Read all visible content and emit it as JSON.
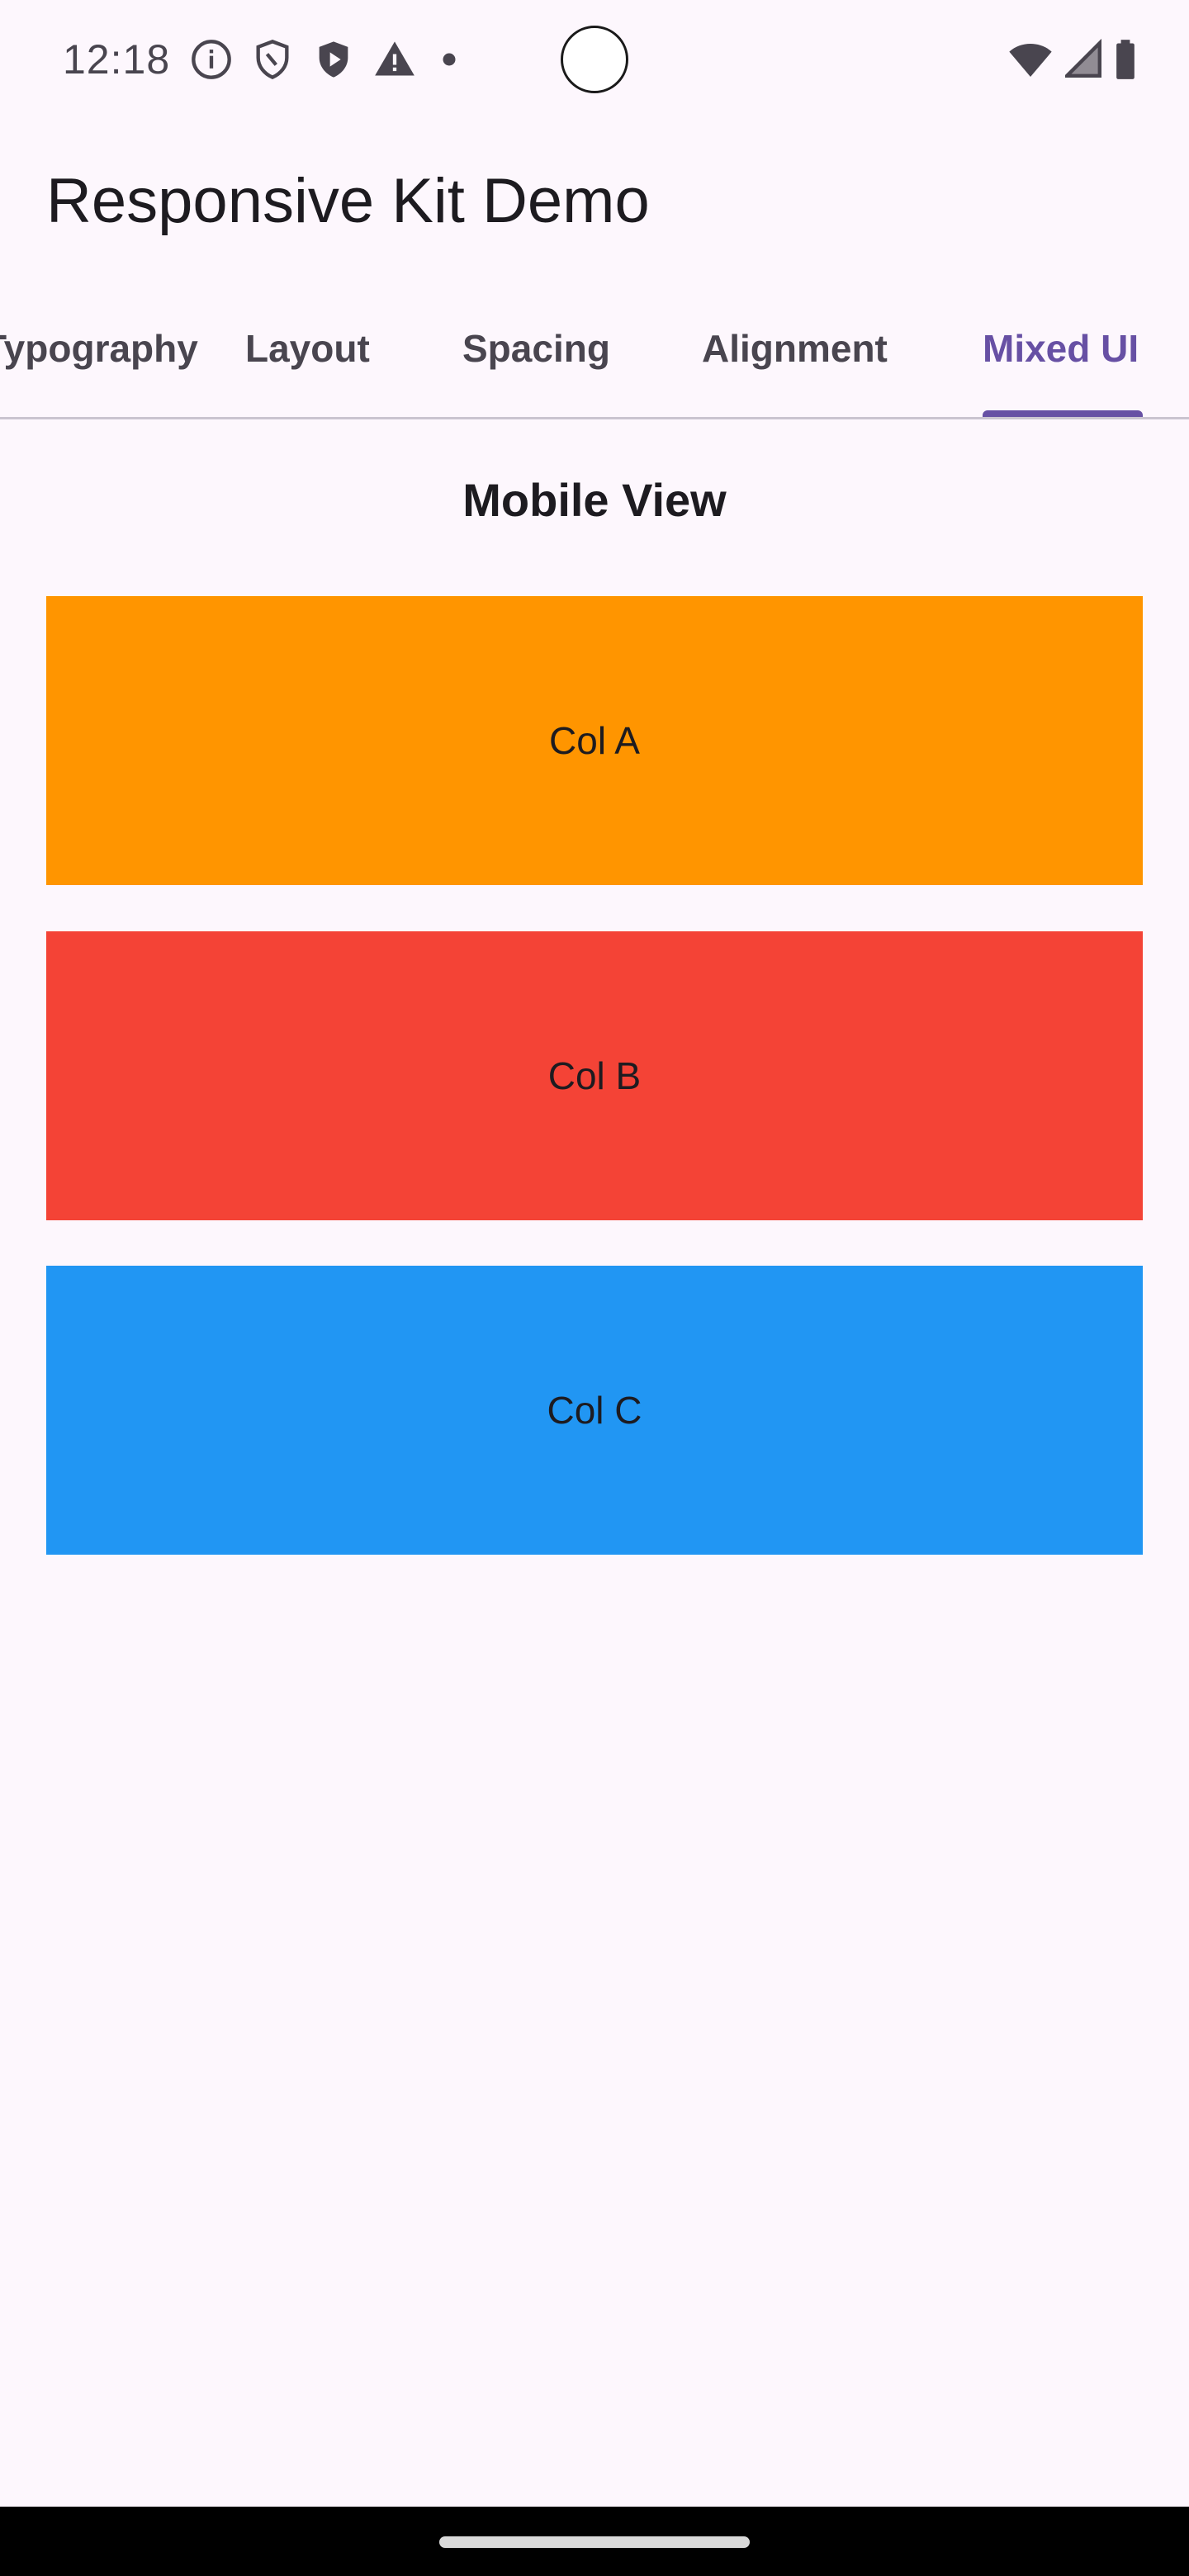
{
  "status_bar": {
    "time": "12:18",
    "icons_left": [
      "info-icon",
      "shield-outline-icon",
      "shield-play-icon",
      "warning-icon",
      "dot-icon"
    ],
    "icons_right": [
      "wifi-icon",
      "signal-icon",
      "battery-icon"
    ]
  },
  "app_bar": {
    "title": "Responsive Kit Demo"
  },
  "tabs": [
    {
      "label": "Typography",
      "active": false
    },
    {
      "label": "Layout",
      "active": false
    },
    {
      "label": "Spacing",
      "active": false
    },
    {
      "label": "Alignment",
      "active": false
    },
    {
      "label": "Mixed UI",
      "active": true
    }
  ],
  "content": {
    "section_title": "Mobile View",
    "columns": [
      {
        "label": "Col A",
        "color": "#ff9500"
      },
      {
        "label": "Col B",
        "color": "#f44336"
      },
      {
        "label": "Col C",
        "color": "#2196f3"
      }
    ]
  },
  "colors": {
    "background": "#fdf7fd",
    "accent": "#6750a4",
    "tab_inactive": "#49454f",
    "divider": "#cac4d0"
  }
}
